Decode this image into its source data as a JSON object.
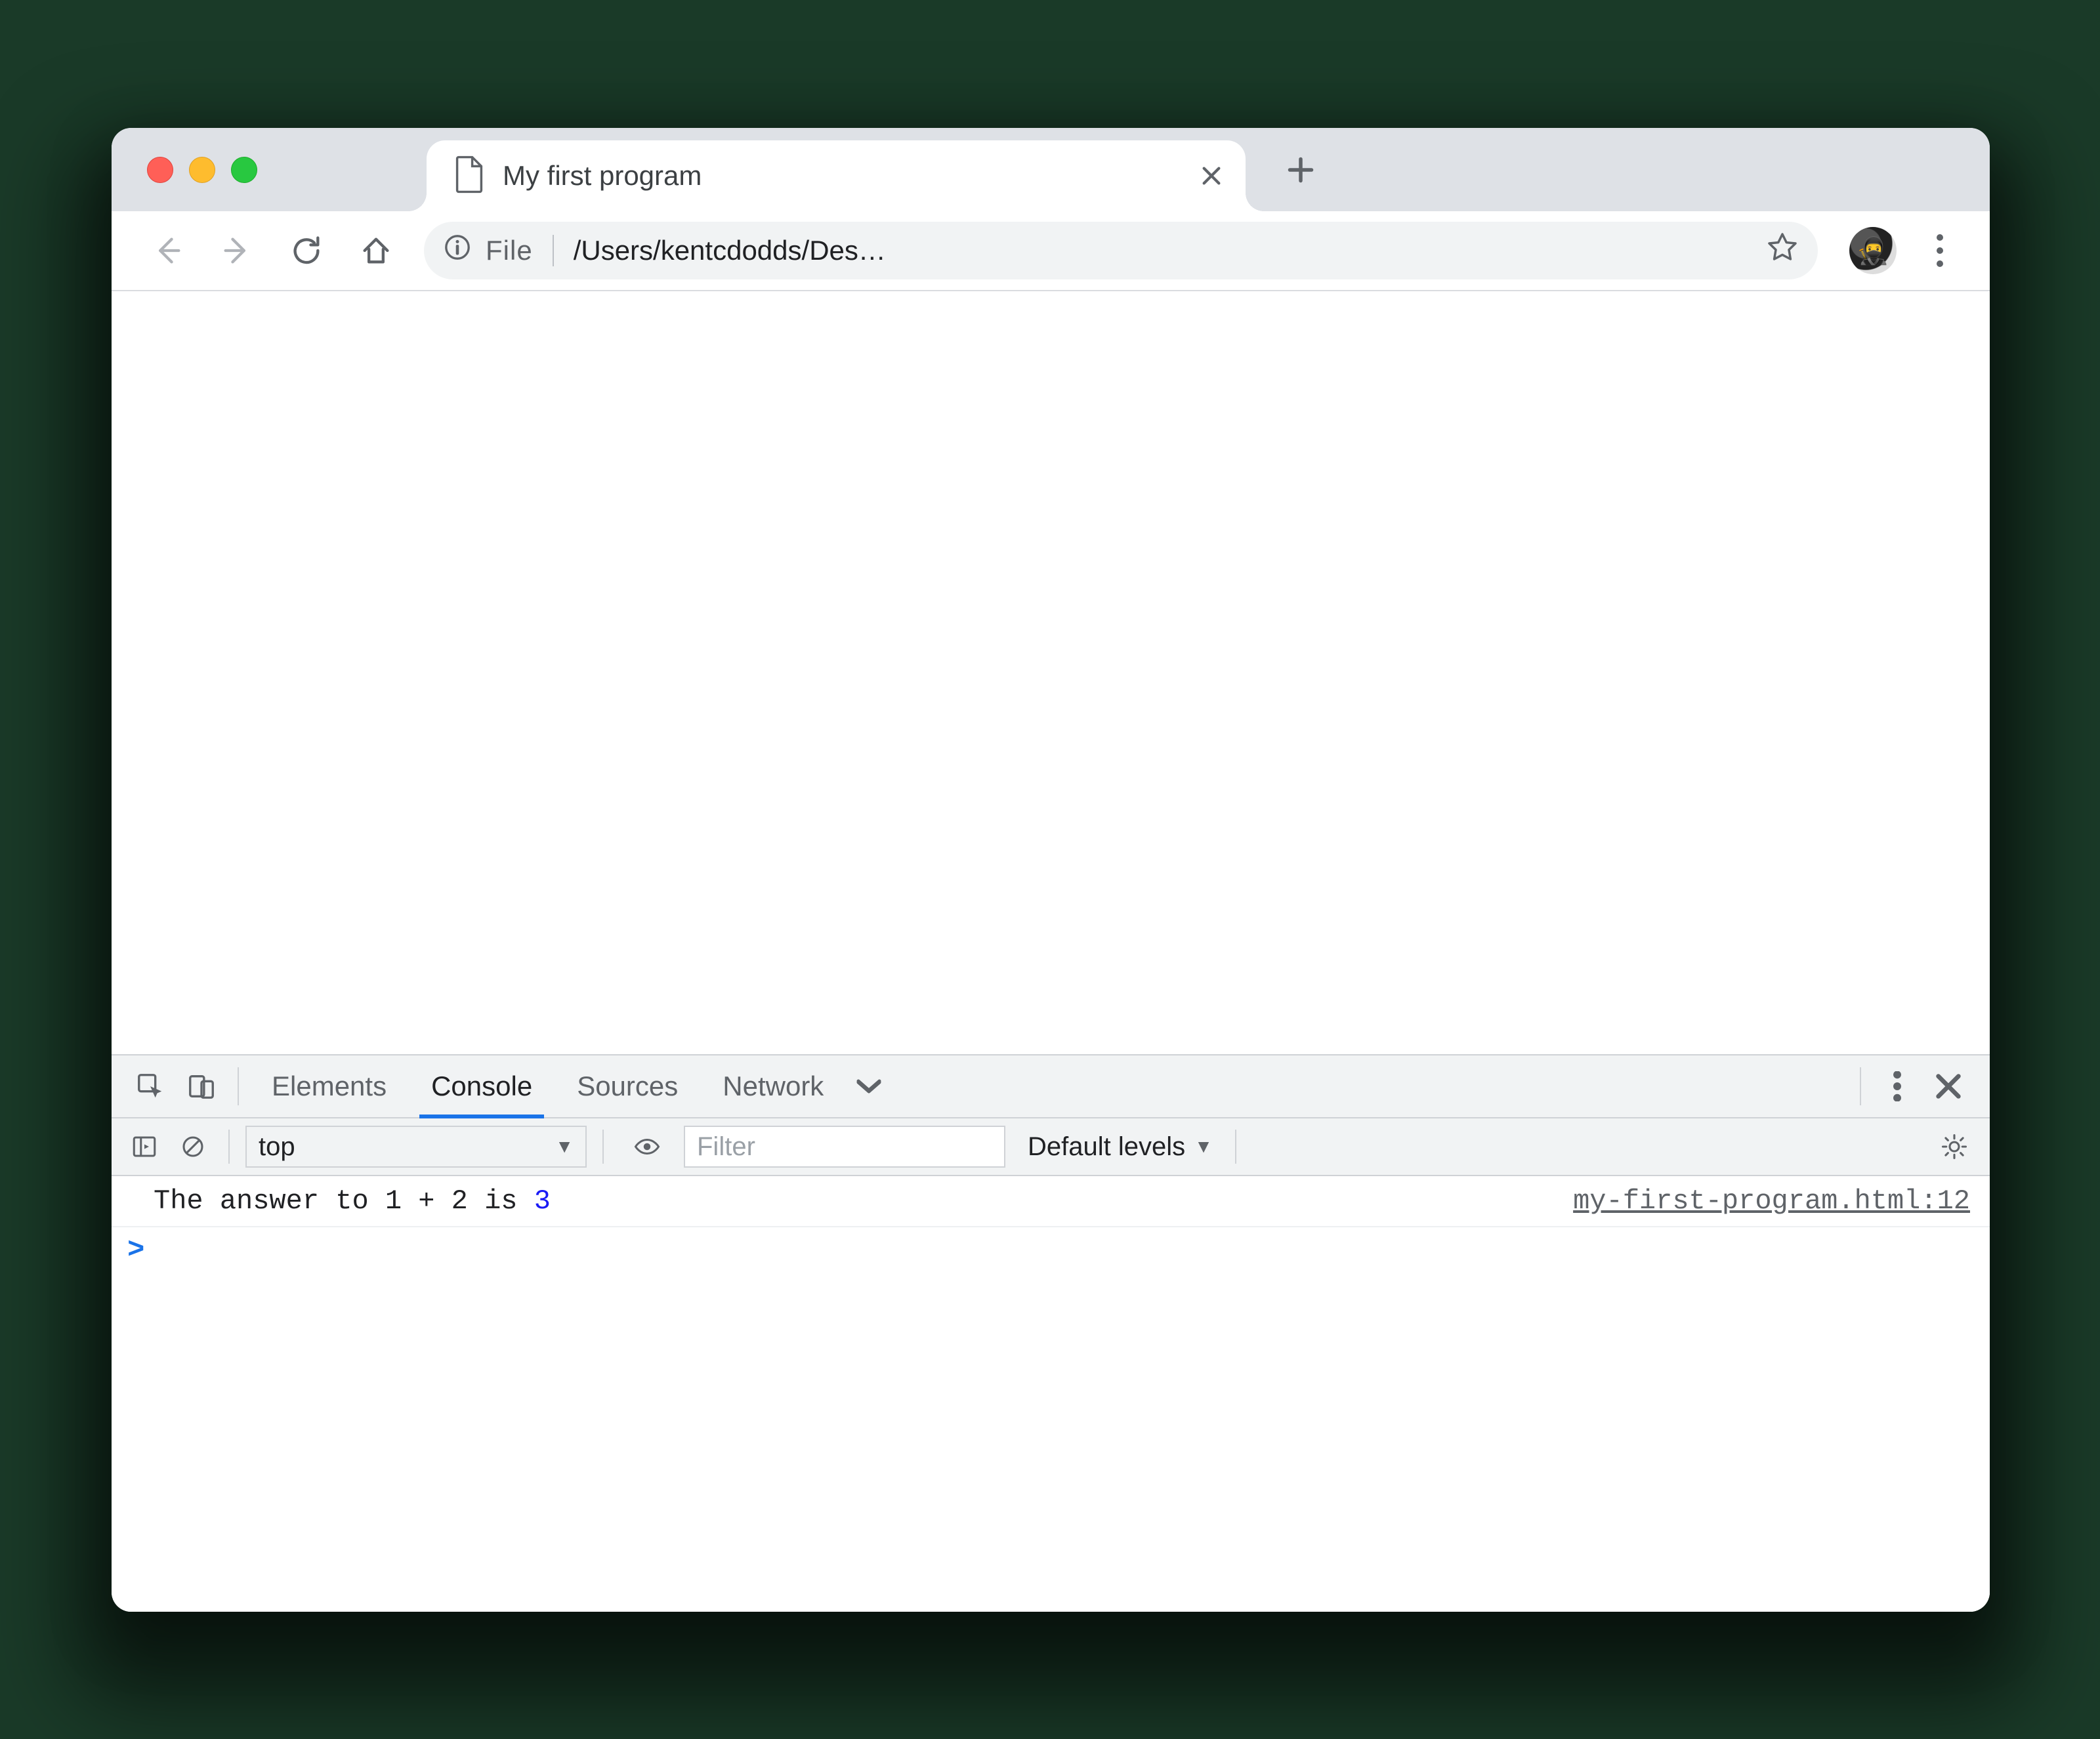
{
  "browser": {
    "tab": {
      "title": "My first program"
    },
    "address": {
      "scheme_label": "File",
      "path": "/Users/kentcdodds/Des…"
    }
  },
  "devtools": {
    "tabs": {
      "elements": "Elements",
      "console": "Console",
      "sources": "Sources",
      "network": "Network"
    },
    "console_toolbar": {
      "context": "top",
      "filter_placeholder": "Filter",
      "levels": "Default levels"
    },
    "log": {
      "message_prefix": "The answer to 1 + 2 is ",
      "message_number": "3",
      "source": "my-first-program.html:12"
    },
    "prompt": ">"
  }
}
